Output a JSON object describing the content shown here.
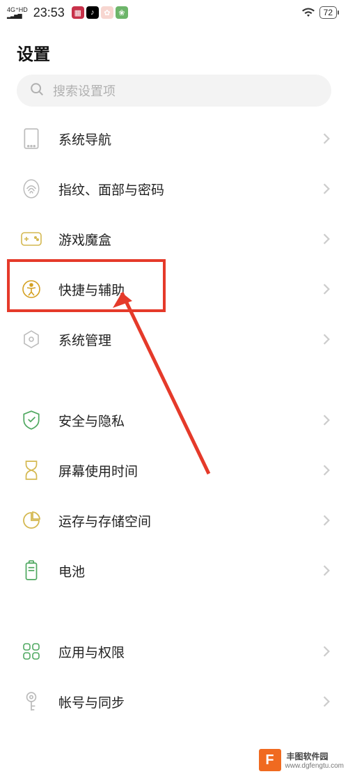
{
  "status": {
    "network_label": "4G⁺HD",
    "time": "23:53",
    "battery": "72"
  },
  "page": {
    "title": "设置",
    "search_placeholder": "搜索设置项"
  },
  "groups": [
    [
      {
        "id": "system-nav",
        "label": "系统导航"
      },
      {
        "id": "biometrics",
        "label": "指纹、面部与密码"
      },
      {
        "id": "game-box",
        "label": "游戏魔盒"
      },
      {
        "id": "shortcuts",
        "label": "快捷与辅助",
        "highlight": true
      },
      {
        "id": "system-mgmt",
        "label": "系统管理"
      }
    ],
    [
      {
        "id": "security",
        "label": "安全与隐私"
      },
      {
        "id": "screen-time",
        "label": "屏幕使用时间"
      },
      {
        "id": "storage",
        "label": "运存与存储空间"
      },
      {
        "id": "battery",
        "label": "电池"
      }
    ],
    [
      {
        "id": "apps",
        "label": "应用与权限"
      },
      {
        "id": "accounts",
        "label": "帐号与同步"
      }
    ]
  ],
  "watermark": {
    "name": "丰图软件园",
    "url": "www.dgfengtu.com"
  }
}
